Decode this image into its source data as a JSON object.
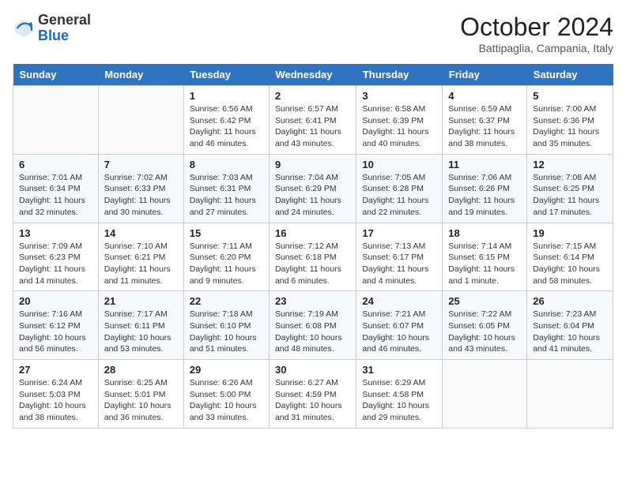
{
  "logo": {
    "general": "General",
    "blue": "Blue"
  },
  "header": {
    "month": "October 2024",
    "location": "Battipaglia, Campania, Italy"
  },
  "weekdays": [
    "Sunday",
    "Monday",
    "Tuesday",
    "Wednesday",
    "Thursday",
    "Friday",
    "Saturday"
  ],
  "weeks": [
    [
      {
        "day": "",
        "info": ""
      },
      {
        "day": "",
        "info": ""
      },
      {
        "day": "1",
        "info": "Sunrise: 6:56 AM\nSunset: 6:42 PM\nDaylight: 11 hours and 46 minutes."
      },
      {
        "day": "2",
        "info": "Sunrise: 6:57 AM\nSunset: 6:41 PM\nDaylight: 11 hours and 43 minutes."
      },
      {
        "day": "3",
        "info": "Sunrise: 6:58 AM\nSunset: 6:39 PM\nDaylight: 11 hours and 40 minutes."
      },
      {
        "day": "4",
        "info": "Sunrise: 6:59 AM\nSunset: 6:37 PM\nDaylight: 11 hours and 38 minutes."
      },
      {
        "day": "5",
        "info": "Sunrise: 7:00 AM\nSunset: 6:36 PM\nDaylight: 11 hours and 35 minutes."
      }
    ],
    [
      {
        "day": "6",
        "info": "Sunrise: 7:01 AM\nSunset: 6:34 PM\nDaylight: 11 hours and 32 minutes."
      },
      {
        "day": "7",
        "info": "Sunrise: 7:02 AM\nSunset: 6:33 PM\nDaylight: 11 hours and 30 minutes."
      },
      {
        "day": "8",
        "info": "Sunrise: 7:03 AM\nSunset: 6:31 PM\nDaylight: 11 hours and 27 minutes."
      },
      {
        "day": "9",
        "info": "Sunrise: 7:04 AM\nSunset: 6:29 PM\nDaylight: 11 hours and 24 minutes."
      },
      {
        "day": "10",
        "info": "Sunrise: 7:05 AM\nSunset: 6:28 PM\nDaylight: 11 hours and 22 minutes."
      },
      {
        "day": "11",
        "info": "Sunrise: 7:06 AM\nSunset: 6:26 PM\nDaylight: 11 hours and 19 minutes."
      },
      {
        "day": "12",
        "info": "Sunrise: 7:08 AM\nSunset: 6:25 PM\nDaylight: 11 hours and 17 minutes."
      }
    ],
    [
      {
        "day": "13",
        "info": "Sunrise: 7:09 AM\nSunset: 6:23 PM\nDaylight: 11 hours and 14 minutes."
      },
      {
        "day": "14",
        "info": "Sunrise: 7:10 AM\nSunset: 6:21 PM\nDaylight: 11 hours and 11 minutes."
      },
      {
        "day": "15",
        "info": "Sunrise: 7:11 AM\nSunset: 6:20 PM\nDaylight: 11 hours and 9 minutes."
      },
      {
        "day": "16",
        "info": "Sunrise: 7:12 AM\nSunset: 6:18 PM\nDaylight: 11 hours and 6 minutes."
      },
      {
        "day": "17",
        "info": "Sunrise: 7:13 AM\nSunset: 6:17 PM\nDaylight: 11 hours and 4 minutes."
      },
      {
        "day": "18",
        "info": "Sunrise: 7:14 AM\nSunset: 6:15 PM\nDaylight: 11 hours and 1 minute."
      },
      {
        "day": "19",
        "info": "Sunrise: 7:15 AM\nSunset: 6:14 PM\nDaylight: 10 hours and 58 minutes."
      }
    ],
    [
      {
        "day": "20",
        "info": "Sunrise: 7:16 AM\nSunset: 6:12 PM\nDaylight: 10 hours and 56 minutes."
      },
      {
        "day": "21",
        "info": "Sunrise: 7:17 AM\nSunset: 6:11 PM\nDaylight: 10 hours and 53 minutes."
      },
      {
        "day": "22",
        "info": "Sunrise: 7:18 AM\nSunset: 6:10 PM\nDaylight: 10 hours and 51 minutes."
      },
      {
        "day": "23",
        "info": "Sunrise: 7:19 AM\nSunset: 6:08 PM\nDaylight: 10 hours and 48 minutes."
      },
      {
        "day": "24",
        "info": "Sunrise: 7:21 AM\nSunset: 6:07 PM\nDaylight: 10 hours and 46 minutes."
      },
      {
        "day": "25",
        "info": "Sunrise: 7:22 AM\nSunset: 6:05 PM\nDaylight: 10 hours and 43 minutes."
      },
      {
        "day": "26",
        "info": "Sunrise: 7:23 AM\nSunset: 6:04 PM\nDaylight: 10 hours and 41 minutes."
      }
    ],
    [
      {
        "day": "27",
        "info": "Sunrise: 6:24 AM\nSunset: 5:03 PM\nDaylight: 10 hours and 38 minutes."
      },
      {
        "day": "28",
        "info": "Sunrise: 6:25 AM\nSunset: 5:01 PM\nDaylight: 10 hours and 36 minutes."
      },
      {
        "day": "29",
        "info": "Sunrise: 6:26 AM\nSunset: 5:00 PM\nDaylight: 10 hours and 33 minutes."
      },
      {
        "day": "30",
        "info": "Sunrise: 6:27 AM\nSunset: 4:59 PM\nDaylight: 10 hours and 31 minutes."
      },
      {
        "day": "31",
        "info": "Sunrise: 6:29 AM\nSunset: 4:58 PM\nDaylight: 10 hours and 29 minutes."
      },
      {
        "day": "",
        "info": ""
      },
      {
        "day": "",
        "info": ""
      }
    ]
  ]
}
